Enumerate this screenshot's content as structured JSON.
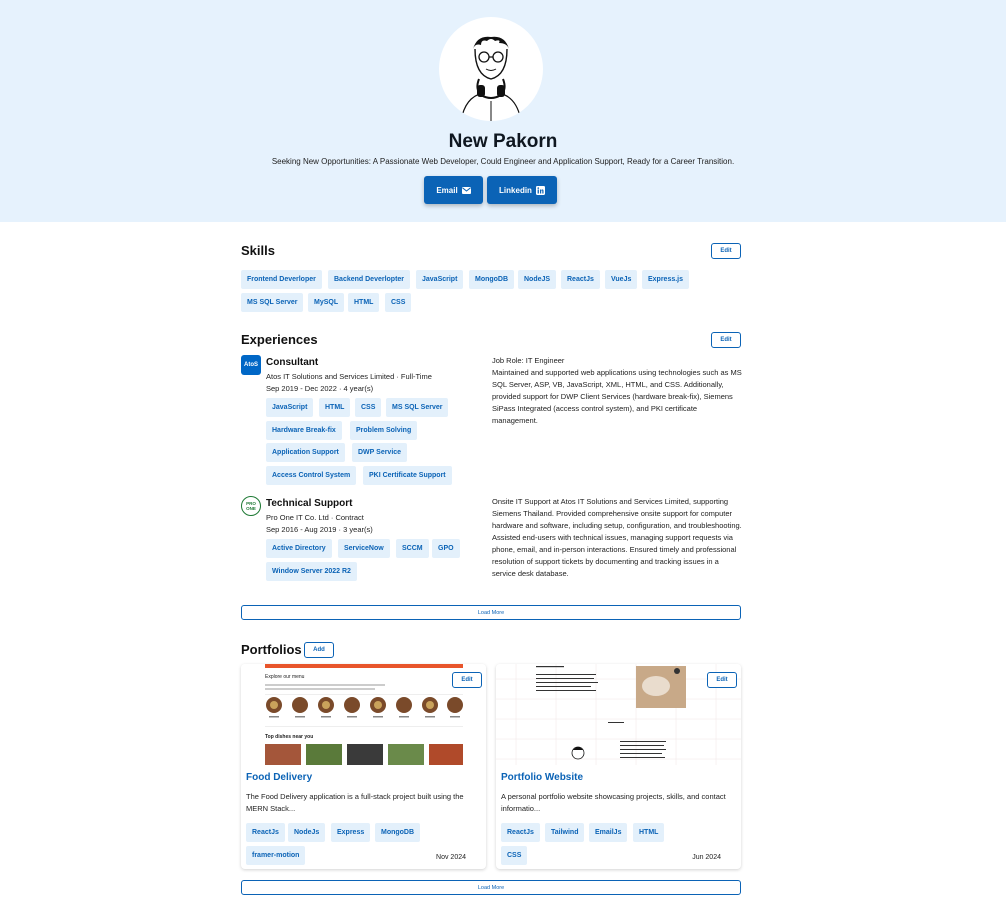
{
  "profile": {
    "name": "New Pakorn",
    "tagline": "Seeking New Opportunities: A Passionate Web Developer, Could Engineer and Application Support, Ready for a Career Transition.",
    "email_label": "Email",
    "linkedin_label": "Linkedin"
  },
  "skills": {
    "title": "Skills",
    "edit_label": "Edit",
    "items": [
      "Frontend Deverloper",
      "Backend Deverlopter",
      "JavaScript",
      "MongoDB",
      "NodeJS",
      "ReactJs",
      "VueJs",
      "Express.js",
      "MS SQL Server",
      "MySQL",
      "HTML",
      "CSS"
    ]
  },
  "experiences": {
    "title": "Experiences",
    "edit_label": "Edit",
    "load_more": "Load More",
    "items": [
      {
        "logo": "AtoS",
        "role": "Consultant",
        "company": "Atos IT Solutions and Services Limited · Full-Time",
        "period": "Sep 2019 - Dec 2022 · 4 year(s)",
        "tags": [
          "JavaScript",
          "HTML",
          "CSS",
          "MS SQL Server",
          "Hardware Break-fix",
          "Problem Solving",
          "Application Support",
          "DWP Service",
          "Access Control System",
          "PKI Certificate Support"
        ],
        "desc_heading": "Job Role: IT Engineer",
        "description": "Maintained and supported web applications using technologies such as MS SQL Server, ASP, VB, JavaScript, XML, HTML, and CSS. Additionally, provided support for DWP Client Services (hardware break-fix), Siemens SiPass Integrated (access control system), and PKI certificate management."
      },
      {
        "logo": "PRO ONE",
        "role": "Technical Support",
        "company": "Pro One IT Co. Ltd · Contract",
        "period": "Sep 2016 - Aug 2019 · 3 year(s)",
        "tags": [
          "Active Directory",
          "ServiceNow",
          "SCCM",
          "GPO",
          "Window Server 2022 R2"
        ],
        "desc_heading": "",
        "description": "Onsite IT Support at Atos IT Solutions and Services Limited, supporting Siemens Thailand. Provided comprehensive onsite support for computer hardware and software, including setup, configuration, and troubleshooting. Assisted end-users with technical issues, managing support requests via phone, email, and in-person interactions. Ensured timely and professional resolution of support tickets by documenting and tracking issues in a service desk database."
      }
    ]
  },
  "portfolios": {
    "title": "Portfolios",
    "add_label": "Add",
    "load_more": "Load More",
    "items": [
      {
        "title": "Food Delivery",
        "description": "The Food Delivery application is a full-stack project built using the MERN Stack...",
        "tags": [
          "ReactJs",
          "NodeJs",
          "Express",
          "MongoDB",
          "framer-motion"
        ],
        "date": "Nov 2024",
        "edit_label": "Edit",
        "preview_heading": "Explore our menu",
        "preview_subheading": "Top dishes near you"
      },
      {
        "title": "Portfolio Website",
        "description": "A personal portfolio website showcasing projects, skills, and contact informatio...",
        "tags": [
          "ReactJs",
          "Tailwind",
          "EmailJs",
          "HTML",
          "CSS"
        ],
        "date": "Jun 2024",
        "edit_label": "Edit"
      }
    ]
  },
  "colors": {
    "hero_bg": "#e6f2fd",
    "accent": "#0b63b6",
    "tag_bg": "#e3f0fb"
  }
}
